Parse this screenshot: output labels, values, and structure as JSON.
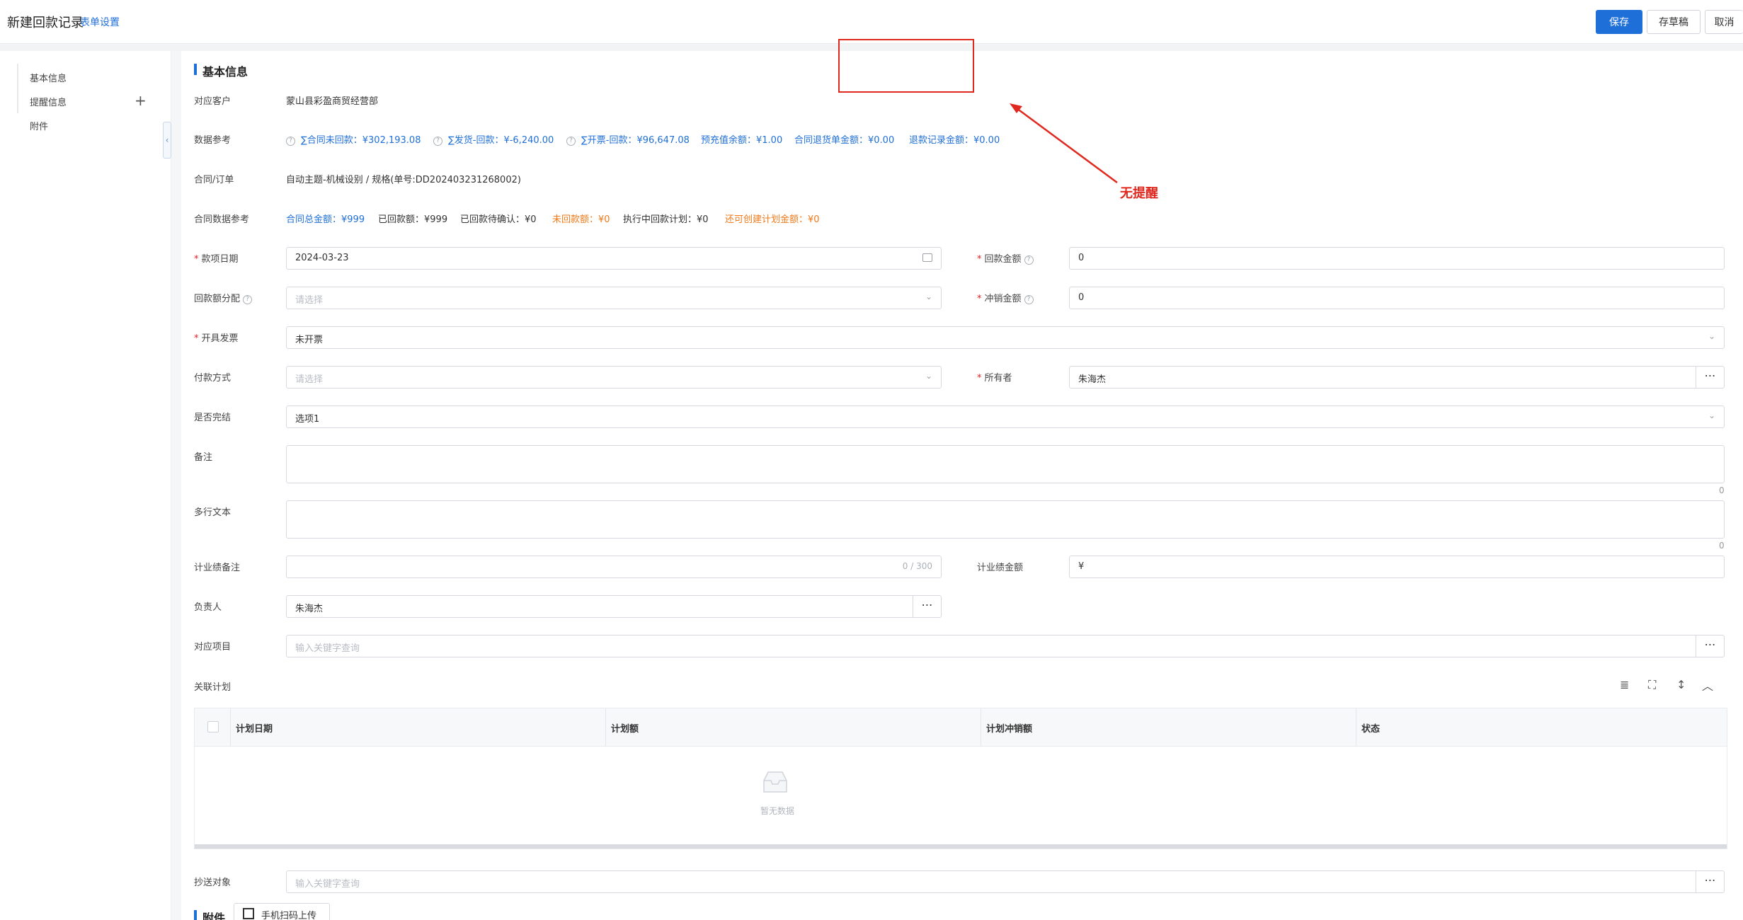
{
  "header": {
    "title": "新建回款记录",
    "form_settings": "表单设置",
    "save_label": "保存",
    "draft_label": "存草稿",
    "cancel_label": "取消"
  },
  "sidebar": {
    "items": [
      "基本信息",
      "提醒信息",
      "附件"
    ],
    "collapse_icon": "chevron-left-icon"
  },
  "section": {
    "basic_title": "基本信息",
    "attachment_title": "附件"
  },
  "customer": {
    "label": "对应客户",
    "value": "蒙山县彩盈商贸经营部"
  },
  "data_ref": {
    "label": "数据参考",
    "contract_unpaid": "∑合同未回款：¥302,193.08",
    "ship_minus_paid": "∑发货-回款：¥-6,240.00",
    "invoice_minus_paid": "∑开票-回款：¥96,647.08",
    "prepaid_balance": "预充值余额：¥1.00",
    "return_order_amount": "合同退货单金额：¥0.00",
    "refund_record_amount": "退款记录金额：¥0.00"
  },
  "contract": {
    "label": "合同/订单",
    "value": "自动主题-机械设别 / 规格(单号:DD202403231268002)"
  },
  "contract_data": {
    "label": "合同数据参考",
    "total": "合同总金额：¥999",
    "received": "已回款额：¥999",
    "pending_confirm": "已回款待确认：¥0",
    "unreceived": "未回款额：¥0",
    "plan_in_progress": "执行中回款计划：¥0",
    "plan_creatable": "还可创建计划金额：¥0"
  },
  "form": {
    "payment_date_label": "款项日期",
    "payment_date_value": "2024-03-23",
    "amount_label": "回款金额",
    "amount_value": "0",
    "allocation_label": "回款额分配",
    "allocation_placeholder": "请选择",
    "writeoff_label": "冲销金额",
    "writeoff_value": "0",
    "invoice_label": "开具发票",
    "invoice_value": "未开票",
    "pay_method_label": "付款方式",
    "pay_method_placeholder": "请选择",
    "owner_label": "所有者",
    "owner_value": "朱海杰",
    "completed_label": "是否完结",
    "completed_value": "选项1",
    "remark_label": "备注",
    "remark_count": "0",
    "multiline_label": "多行文本",
    "multiline_count": "0",
    "perf_remark_label": "计业绩备注",
    "perf_remark_counter": "0 / 300",
    "perf_amount_label": "计业绩金额",
    "perf_amount_prefix": "¥",
    "responsible_label": "负责人",
    "responsible_value": "朱海杰",
    "project_label": "对应项目",
    "project_placeholder": "输入关键字查询",
    "cc_label": "抄送对象",
    "cc_placeholder": "输入关键字查询"
  },
  "plan_table": {
    "label": "关联计划",
    "columns": [
      "计划日期",
      "计划额",
      "计划冲销额",
      "状态"
    ],
    "empty_text": "暂无数据"
  },
  "upload": {
    "mobile_scan_label": "手机扫码上传"
  },
  "annotation": {
    "text": "无提醒",
    "color": "#e0281e"
  },
  "colors": {
    "primary": "#1f6fd8",
    "orange": "#f07a1a",
    "required": "#e02020"
  }
}
